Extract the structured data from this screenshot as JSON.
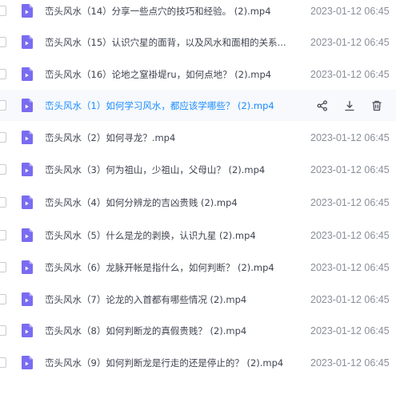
{
  "files": [
    {
      "name": "峦头风水（14）分享一些点穴的技巧和经验。 (2).mp4",
      "date": "2023-01-12 06:45"
    },
    {
      "name": "峦头风水（15）认识穴星的面背，以及风水和面相的关系...",
      "date": "2023-01-12 06:45"
    },
    {
      "name": "峦头风水（16）论地之窒褂堤ru，如何点地？ (2).mp4",
      "date": "2023-01-12 06:45"
    },
    {
      "name": "峦头风水（1）如何学习风水，都应该学哪些？ (2).mp4",
      "date": "",
      "hovered": true
    },
    {
      "name": "峦头风水（2）如何寻龙？.mp4",
      "date": "2023-01-12 06:45"
    },
    {
      "name": "峦头风水（3）何为祖山，少祖山，父母山？ (2).mp4",
      "date": "2023-01-12 06:45"
    },
    {
      "name": "峦头风水（4）如何分辨龙的吉凶贵贱 (2).mp4",
      "date": "2023-01-12 06:45"
    },
    {
      "name": "峦头风水（5）什么是龙的剥换，认识九星 (2).mp4",
      "date": "2023-01-12 06:45"
    },
    {
      "name": "峦头风水（6）龙脉开帐是指什么，如何判断？ (2).mp4",
      "date": "2023-01-12 06:45"
    },
    {
      "name": "峦头风水（7）论龙的入首都有哪些情况 (2).mp4",
      "date": "2023-01-12 06:45"
    },
    {
      "name": "峦头风水（8）如何判断龙的真假贵贱？ (2).mp4",
      "date": "2023-01-12 06:45"
    },
    {
      "name": "峦头风水（9）如何判断龙是行走的还是停止的？ (2).mp4",
      "date": "2023-01-12 06:45"
    }
  ],
  "hover_actions": [
    "share-icon",
    "download-icon",
    "delete-icon",
    "more-icon"
  ],
  "colors": {
    "accent": "#1a8cff",
    "icon": "#7a6cf0",
    "text": "#3f4450",
    "date": "#8a8f99"
  }
}
